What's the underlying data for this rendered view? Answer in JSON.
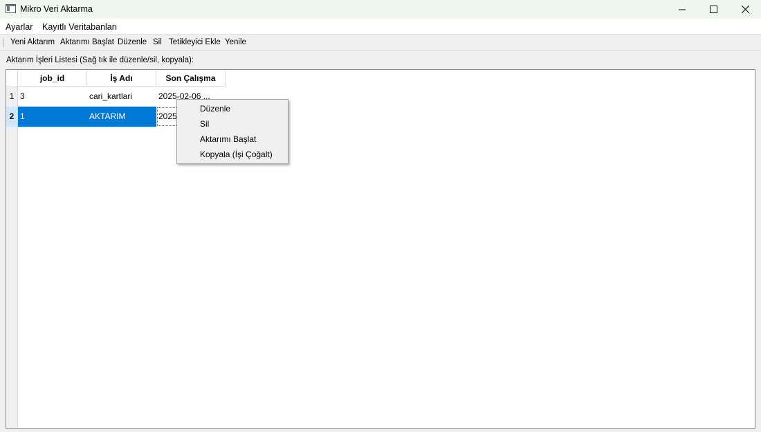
{
  "window": {
    "title": "Mikro Veri Aktarma",
    "controls": {
      "minimize": "minimize-icon",
      "maximize": "maximize-icon",
      "close": "close-icon"
    }
  },
  "menubar": {
    "items": [
      "Ayarlar",
      "Kayıtlı Veritabanları"
    ]
  },
  "toolbar": {
    "items": [
      "Yeni Aktarım",
      "Aktarımı Başlat",
      "Düzenle",
      "Sil",
      "Tetikleyici Ekle",
      "Yenile"
    ]
  },
  "list_label": "Aktarım İşleri Listesi (Sağ tık ile düzenle/sil, kopyala):",
  "table": {
    "columns": [
      "job_id",
      "İş Adı",
      "Son Çalışma"
    ],
    "rows": [
      {
        "num": "1",
        "job_id": "3",
        "name": "cari_kartlari",
        "last_run": "2025-02-06 ..."
      },
      {
        "num": "2",
        "job_id": "1",
        "name": "AKTARIM",
        "last_run": "2025-"
      }
    ],
    "selected_row": "2"
  },
  "context_menu": {
    "items": [
      "Düzenle",
      "Sil",
      "Aktarımı Başlat",
      "Kopyala (İşi Çoğalt)"
    ]
  },
  "colors": {
    "selection": "#0078d7",
    "titlebar": "#f0f7f1"
  }
}
